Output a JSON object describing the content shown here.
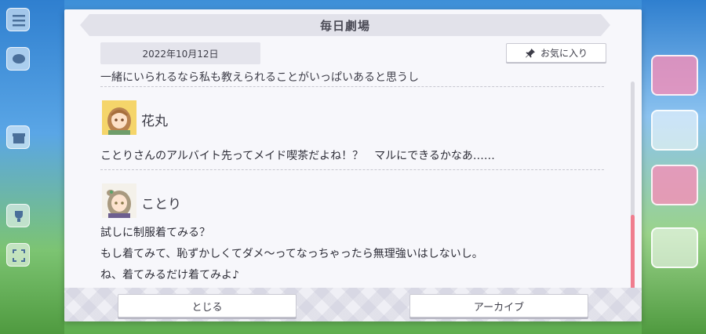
{
  "dialog": {
    "title": "毎日劇場",
    "date": "2022年10月12日",
    "favorite_label": "お気に入り",
    "truncated_previous_line": "一緒にいられるなら私も教えられることがいっぱいあると思うし",
    "entries": [
      {
        "speaker": "花丸",
        "lines": [
          "ことりさんのアルバイト先ってメイド喫茶だよね！？　マルにできるかなあ……"
        ]
      },
      {
        "speaker": "ことり",
        "lines": [
          "試しに制服着てみる？",
          "もし着てみて、恥ずかしくてダメ～ってなっちゃったら無理強いはしないし。",
          "ね、着てみるだけ着てみよ♪"
        ]
      }
    ],
    "close_label": "とじる",
    "archive_label": "アーカイブ"
  },
  "colors": {
    "accent_scroll": "#f07d8e",
    "panel_bg": "#f7f7fb"
  }
}
